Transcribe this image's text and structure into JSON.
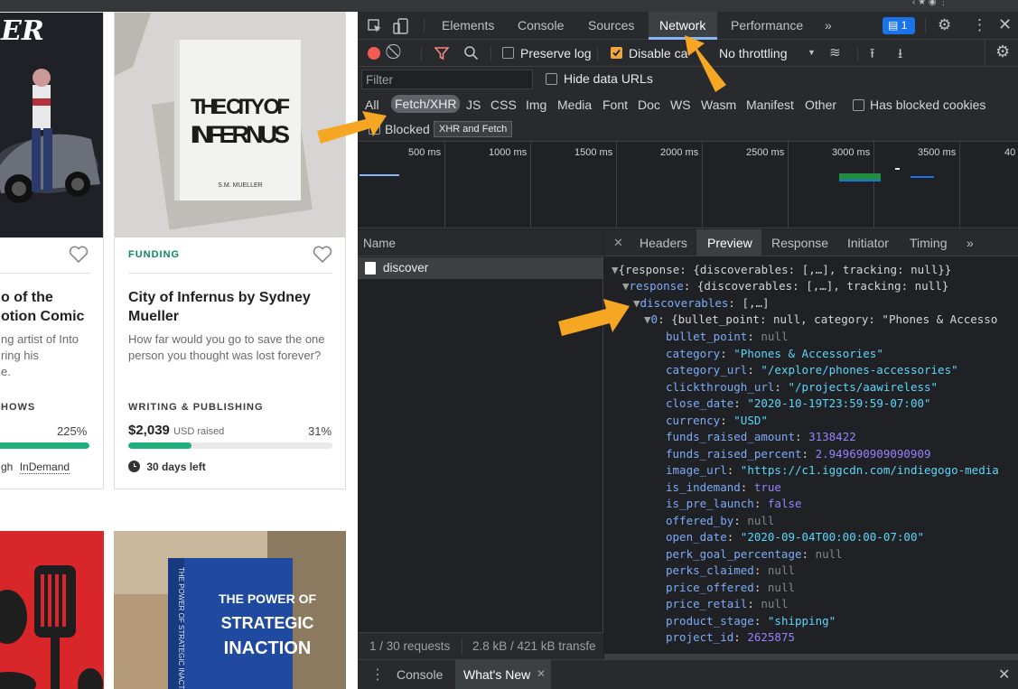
{
  "page": {
    "card_left": {
      "title_line1": "o of the",
      "title_line2": "otion Comic",
      "desc_line1": "ng artist of Into",
      "desc_line2": "ring his",
      "desc_line3": "e.",
      "category": "HOWS",
      "percent": "225%",
      "funding_fraction": 1.0,
      "footer": "gh",
      "footer_link": "InDemand"
    },
    "card_right": {
      "book_title_line1": "THE CITY OF",
      "book_title_line2": "INFERNUS",
      "book_author": "S.M. MUELLER",
      "badge": "FUNDING",
      "title_line1": "City of Infernus by Sydney",
      "title_line2": "Mueller",
      "desc_line1": "How far would you go to save the one",
      "desc_line2": "person you thought was lost forever?",
      "category": "WRITING & PUBLISHING",
      "amount": "$2,039",
      "amount_suffix": "USD raised",
      "percent": "31%",
      "funding_fraction": 0.31,
      "days_left": "30 days left"
    },
    "card_bottom_right": {
      "book_title_line1": "THE POWER OF",
      "book_title_line2": "STRATEGIC",
      "book_title_line3": "INACTION",
      "spine_text": "THE POWER OF STRATEGIC INACTION"
    },
    "banner_text": "ER"
  },
  "devtools": {
    "tabs": [
      "Elements",
      "Console",
      "Sources",
      "Network",
      "Performance",
      "»"
    ],
    "active_tab": "Network",
    "badge_count": "1",
    "toolbar": {
      "preserve_log": "Preserve log",
      "disable_cache": "Disable ca",
      "throttling": "No throttling"
    },
    "filter_placeholder": "Filter",
    "hide_data_urls": "Hide data URLs",
    "types": [
      "All",
      "Fetch/XHR",
      "JS",
      "CSS",
      "Img",
      "Media",
      "Font",
      "Doc",
      "WS",
      "Wasm",
      "Manifest",
      "Other"
    ],
    "has_blocked_cookies": "Has blocked cookies",
    "blocked": "Blocked",
    "tooltip": "XHR and Fetch",
    "timeline_ticks": [
      "500 ms",
      "1000 ms",
      "1500 ms",
      "2000 ms",
      "2500 ms",
      "3000 ms",
      "3500 ms",
      "40"
    ],
    "requests": {
      "header": "Name",
      "rows": [
        "discover"
      ],
      "footer_count": "1 / 30 requests",
      "footer_size": "2.8 kB / 421 kB transfe"
    },
    "detail_tabs": [
      "Headers",
      "Preview",
      "Response",
      "Initiator",
      "Timing",
      "»"
    ],
    "active_detail_tab": "Preview",
    "preview": {
      "root": "{response: {discoverables: [,…], tracking: null}}",
      "response": "{discoverables: [,…], tracking: null}",
      "discoverables": "[,…]",
      "item0": "{bullet_point: null, category: \"Phones & Accesso",
      "fields": [
        {
          "key": "bullet_point",
          "value": "null",
          "type": "null"
        },
        {
          "key": "category",
          "value": "\"Phones & Accessories\"",
          "type": "string"
        },
        {
          "key": "category_url",
          "value": "\"/explore/phones-accessories\"",
          "type": "string"
        },
        {
          "key": "clickthrough_url",
          "value": "\"/projects/aawireless\"",
          "type": "string"
        },
        {
          "key": "close_date",
          "value": "\"2020-10-19T23:59:59-07:00\"",
          "type": "string"
        },
        {
          "key": "currency",
          "value": "\"USD\"",
          "type": "string"
        },
        {
          "key": "funds_raised_amount",
          "value": "3138422",
          "type": "number"
        },
        {
          "key": "funds_raised_percent",
          "value": "2.949690909090909",
          "type": "number"
        },
        {
          "key": "image_url",
          "value": "\"https://c1.iggcdn.com/indiegogo-media",
          "type": "string"
        },
        {
          "key": "is_indemand",
          "value": "true",
          "type": "bool"
        },
        {
          "key": "is_pre_launch",
          "value": "false",
          "type": "bool"
        },
        {
          "key": "offered_by",
          "value": "null",
          "type": "null"
        },
        {
          "key": "open_date",
          "value": "\"2020-09-04T00:00:00-07:00\"",
          "type": "string"
        },
        {
          "key": "perk_goal_percentage",
          "value": "null",
          "type": "null"
        },
        {
          "key": "perks_claimed",
          "value": "null",
          "type": "null"
        },
        {
          "key": "price_offered",
          "value": "null",
          "type": "null"
        },
        {
          "key": "price_retail",
          "value": "null",
          "type": "null"
        },
        {
          "key": "product_stage",
          "value": "\"shipping\"",
          "type": "string"
        },
        {
          "key": "project_id",
          "value": "2625875",
          "type": "number"
        }
      ]
    },
    "drawer_tabs": [
      "Console",
      "What's New"
    ],
    "active_drawer_tab": "What's New"
  },
  "colors": {
    "accent_funding": "#0b8a5f",
    "progress": "#21b07b",
    "annotation_arrow": "#f5a623",
    "devtools_bg": "#202124",
    "active_tab_underline": "#8ab4f8"
  }
}
